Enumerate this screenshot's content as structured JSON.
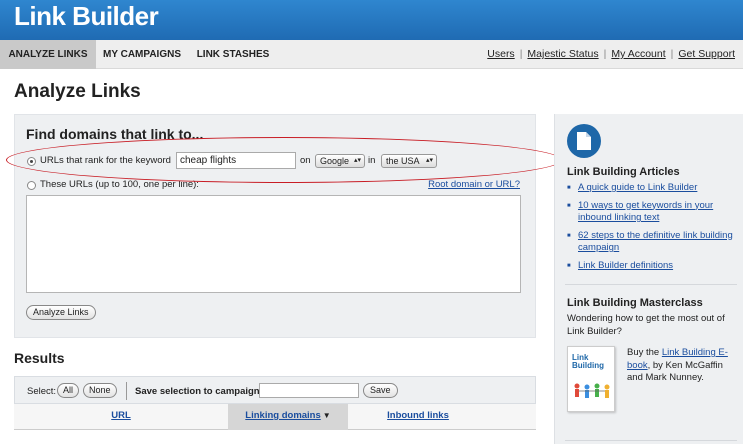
{
  "app": {
    "title": "Link Builder"
  },
  "nav": {
    "tabs": [
      {
        "label": "ANALYZE LINKS",
        "active": true
      },
      {
        "label": "MY CAMPAIGNS",
        "active": false
      },
      {
        "label": "LINK STASHES",
        "active": false
      }
    ],
    "util_links": [
      "Users",
      "Majestic Status",
      "My Account",
      "Get Support"
    ]
  },
  "page": {
    "title": "Analyze Links"
  },
  "find": {
    "title": "Find domains that link to...",
    "keyword_label": "URLs that rank for the keyword",
    "keyword_value": "cheap flights",
    "on_label": "on",
    "engine_value": "Google",
    "in_label": "in",
    "country_value": "the USA",
    "urls_label": "These URLs (up to 100, one per line):",
    "help_link": "Root domain or URL?",
    "analyze_button": "Analyze Links"
  },
  "results": {
    "title": "Results",
    "select_label": "Select:",
    "all_button": "All",
    "none_button": "None",
    "campaign_label": "Save selection to campaign:",
    "campaign_value": "",
    "save_button": "Save",
    "columns": [
      "URL",
      "Linking domains",
      "Inbound links"
    ],
    "sorted_column": "Linking domains"
  },
  "sidebar": {
    "articles_title": "Link Building Articles",
    "articles": [
      "A quick guide to Link Builder",
      "10 ways to get keywords in your inbound linking text",
      "62 steps to the definitive link building campaign",
      "Link Builder definitions"
    ],
    "masterclass_title": "Link Building Masterclass",
    "masterclass_text": "Wondering how to get the most out of Link Builder?",
    "cover_title": "Link Building",
    "buy_prefix": "Buy the",
    "buy_link": "Link Building E-book",
    "buy_suffix": ", by Ken McGaffin and Mark Nunney."
  },
  "colors": {
    "header_blue": "#1f6bb3",
    "link_blue": "#1a4d9e",
    "panel_gray": "#eef0f2",
    "highlight_red": "#c81d25"
  }
}
